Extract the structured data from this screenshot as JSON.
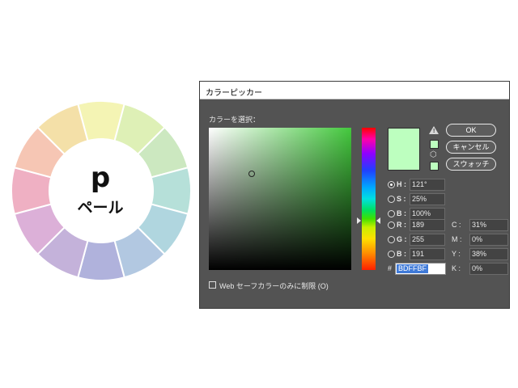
{
  "wheel": {
    "letter": "p",
    "name": "ペール",
    "segment_colors": [
      "#f4f4b4",
      "#def0b6",
      "#cce8c0",
      "#b6e0d9",
      "#b0d6df",
      "#b2c8e1",
      "#b0b2dc",
      "#c4b2da",
      "#dcb0d8",
      "#efb0c3",
      "#f6c6b4",
      "#f4e0a8"
    ]
  },
  "dialog": {
    "title": "カラーピッカー",
    "select_label": "カラーを選択：",
    "buttons": {
      "ok": "OK",
      "cancel": "キャンセル",
      "swatches": "スウォッチ"
    },
    "current_color": "#BDFFBF",
    "field_hue_color": "#43c83d",
    "hsb": [
      {
        "label": "H :",
        "value": "121°",
        "selected": true
      },
      {
        "label": "S :",
        "value": "25%",
        "selected": false
      },
      {
        "label": "B :",
        "value": "100%",
        "selected": false
      }
    ],
    "rgb": [
      {
        "label": "R :",
        "value": "189",
        "selected": false
      },
      {
        "label": "G :",
        "value": "255",
        "selected": false
      },
      {
        "label": "B :",
        "value": "191",
        "selected": false
      }
    ],
    "cmyk": [
      {
        "label": "C :",
        "value": "31%"
      },
      {
        "label": "M :",
        "value": "0%"
      },
      {
        "label": "Y :",
        "value": "38%"
      },
      {
        "label": "K :",
        "value": "0%"
      }
    ],
    "hex_label": "#",
    "hex_value": "BDFFBF",
    "websafe_label": "Web セーフカラーのみに制限 (O)",
    "websafe_checked": false,
    "icons": {
      "gamut_warning": "warning-triangle-icon",
      "websafe": "cube-icon"
    }
  }
}
